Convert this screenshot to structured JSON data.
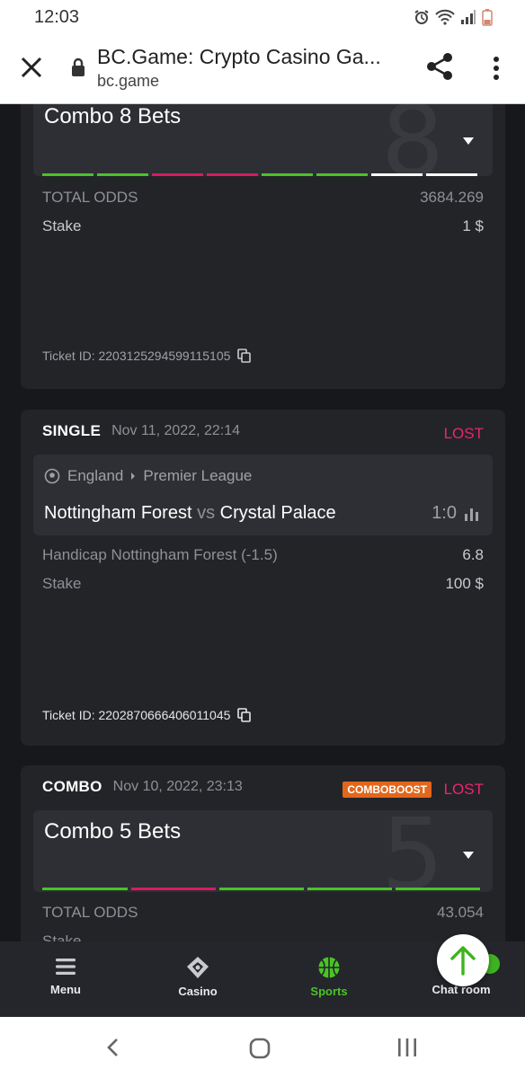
{
  "status_bar": {
    "time": "12:03"
  },
  "browser": {
    "title": "BC.Game: Crypto Casino Ga...",
    "url": "bc.game"
  },
  "bets": [
    {
      "combo_title": "Combo 8 Bets",
      "big_number": "8",
      "bars": [
        "#49c426",
        "#49c426",
        "#d81b60",
        "#d81b60",
        "#49c426",
        "#49c426",
        "#ffffff",
        "#ffffff"
      ],
      "total_odds_label": "TOTAL ODDS",
      "total_odds_value": "3684.269",
      "stake_label": "Stake",
      "stake_value": "1 $",
      "ticket_id": "Ticket ID: 2203125294599115105"
    },
    {
      "type": "SINGLE",
      "date": "Nov 11, 2022, 22:14",
      "status": "LOST",
      "country": "England",
      "league": "Premier League",
      "home": "Nottingham Forest",
      "vs": "vs",
      "away": "Crystal Palace",
      "score": "1:0",
      "market": "Handicap Nottingham Forest (-1.5)",
      "odds": "6.8",
      "stake_label": "Stake",
      "stake_value": "100 $",
      "ticket_id": "Ticket ID: 2202870666406011045"
    },
    {
      "type": "COMBO",
      "date": "Nov 10, 2022, 23:13",
      "boost": "COMBOBOOST",
      "status": "LOST",
      "combo_title": "Combo 5 Bets",
      "big_number": "5",
      "bars": [
        "#49c426",
        "#d81b60",
        "#49c426",
        "#49c426",
        "#49c426"
      ],
      "total_odds_label": "TOTAL ODDS",
      "total_odds_value": "43.054",
      "stake_label": "Stake"
    }
  ],
  "nav": {
    "menu": "Menu",
    "casino": "Casino",
    "sports": "Sports",
    "chat": "Chat room"
  },
  "colors": {
    "accent": "#49c426",
    "lost": "#e8266f",
    "boost": "#e2671c"
  }
}
